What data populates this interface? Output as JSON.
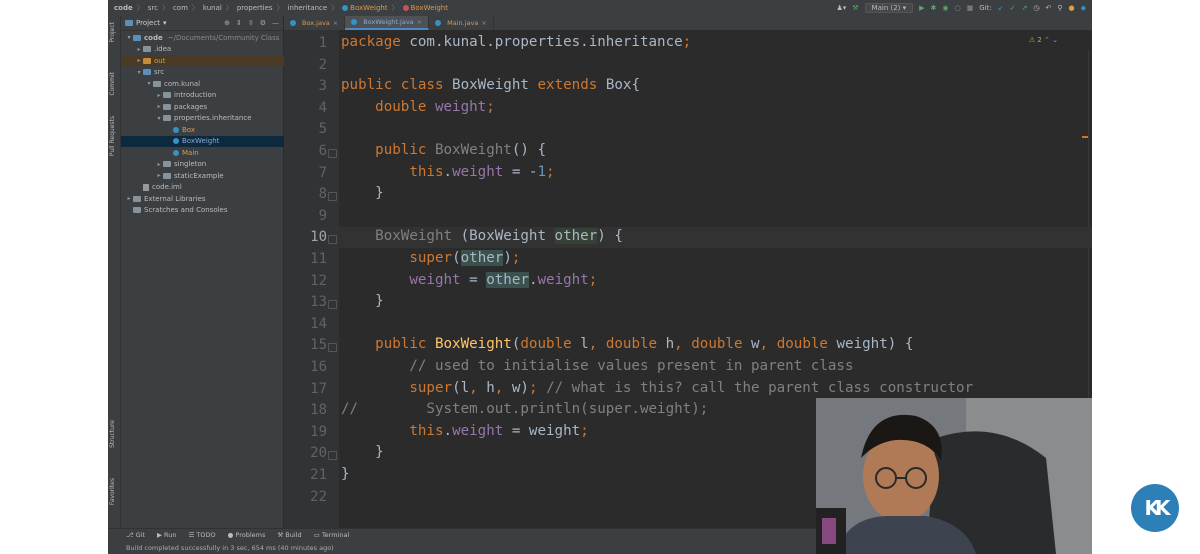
{
  "breadcrumb": [
    "code",
    "src",
    "com",
    "kunal",
    "properties",
    "inheritance",
    "BoxWeight",
    "BoxWeight"
  ],
  "toolbar": {
    "branch": "Main (2)",
    "git_label": "Git:"
  },
  "sidebar_tabs": {
    "project": "Project",
    "commit": "Commit",
    "pull_requests": "Pull Requests",
    "structure": "Structure",
    "favorites": "Favorites"
  },
  "project_panel": {
    "title": "Project",
    "tree": [
      {
        "label": "code",
        "extra": "~/Documents/Community Class",
        "kind": "folder-blue",
        "indent": 0,
        "arrow": "▾"
      },
      {
        "label": ".idea",
        "kind": "folder",
        "indent": 1,
        "arrow": "▸"
      },
      {
        "label": "out",
        "kind": "folder-orange",
        "indent": 1,
        "arrow": "▸"
      },
      {
        "label": "src",
        "kind": "folder-blue",
        "indent": 1,
        "arrow": "▾"
      },
      {
        "label": "com.kunal",
        "kind": "folder",
        "indent": 2,
        "arrow": "▾"
      },
      {
        "label": "introduction",
        "kind": "folder",
        "indent": 3,
        "arrow": "▸"
      },
      {
        "label": "packages",
        "kind": "folder",
        "indent": 3,
        "arrow": "▸"
      },
      {
        "label": "properties.inheritance",
        "kind": "folder",
        "indent": 3,
        "arrow": "▾"
      },
      {
        "label": "Box",
        "kind": "class",
        "indent": 4,
        "arrow": ""
      },
      {
        "label": "BoxWeight",
        "kind": "class",
        "indent": 4,
        "arrow": "",
        "selected": true
      },
      {
        "label": "Main",
        "kind": "class",
        "indent": 4,
        "arrow": ""
      },
      {
        "label": "singleton",
        "kind": "folder",
        "indent": 3,
        "arrow": "▸"
      },
      {
        "label": "staticExample",
        "kind": "folder",
        "indent": 3,
        "arrow": "▸"
      },
      {
        "label": "code.iml",
        "kind": "file",
        "indent": 1,
        "arrow": ""
      },
      {
        "label": "External Libraries",
        "kind": "folder",
        "indent": 0,
        "arrow": "▸"
      },
      {
        "label": "Scratches and Consoles",
        "kind": "folder",
        "indent": 0,
        "arrow": ""
      }
    ]
  },
  "tabs": [
    {
      "label": "Box.java",
      "active": false
    },
    {
      "label": "BoxWeight.java",
      "active": true
    },
    {
      "label": "Main.java",
      "active": false
    }
  ],
  "editor": {
    "warnings": "2",
    "current_line": 10,
    "lines": [
      "package com.kunal.properties.inheritance;",
      "",
      "public class BoxWeight extends Box{",
      "    double weight;",
      "",
      "    public BoxWeight() {",
      "        this.weight = -1;",
      "    }",
      "",
      "    BoxWeight (BoxWeight other) {",
      "        super(other);",
      "        weight = other.weight;",
      "    }",
      "",
      "    public BoxWeight(double l, double h, double w, double weight) {",
      "        // used to initialise values present in parent class",
      "        super(l, h, w); // what is this? call the parent class constructor",
      "//        System.out.println(super.weight);",
      "        this.weight = weight;",
      "    }",
      "}",
      ""
    ]
  },
  "bottom_tools": [
    "Git",
    "Run",
    "TODO",
    "Problems",
    "Build",
    "Terminal"
  ],
  "status": "Build completed successfully in 3 sec, 654 ms (40 minutes ago)",
  "logo_text": "KK",
  "colors": {
    "background": "#2b2b2b",
    "keyword": "#cc7832",
    "field": "#9876aa",
    "number": "#6897bb",
    "comment": "#808080",
    "logo": "#2d7fb8"
  }
}
